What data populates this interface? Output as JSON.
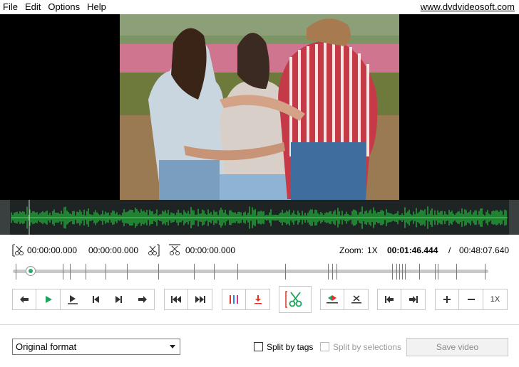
{
  "menu": {
    "items": [
      "File",
      "Edit",
      "Options",
      "Help"
    ],
    "site_link": "www.dvdvideosoft.com"
  },
  "timeline": {
    "selection_start": "00:00:00.000",
    "selection_end": "00:00:00.000",
    "selection_length": "00:00:00.000",
    "zoom_label": "Zoom:",
    "zoom_value": "1X",
    "current_time": "00:01:46.444",
    "separator": "/",
    "total_time": "00:48:07.640",
    "playhead_fraction": 0.037
  },
  "toolbar": {
    "zoom_reset_label": "1X"
  },
  "bottom": {
    "format_selected": "Original format",
    "split_by_tags": "Split by tags",
    "split_by_selections": "Split by selections",
    "save_video": "Save video"
  },
  "colors": {
    "accent_green": "#1aa35a",
    "accent_red": "#e0342b",
    "accent_blue": "#1e88e5"
  }
}
